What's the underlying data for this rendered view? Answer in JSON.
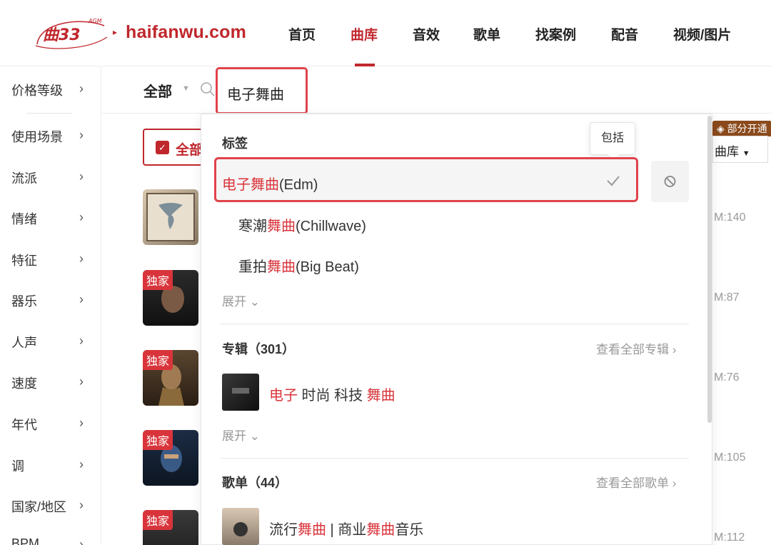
{
  "header": {
    "logo_text": "曲33",
    "logo_superscript": "AGM",
    "site_name": "haifanwu.com",
    "nav": [
      "首页",
      "曲库",
      "音效",
      "歌单",
      "找案例",
      "配音",
      "视频/图片"
    ],
    "active_nav": "曲库"
  },
  "sidebar": {
    "items": [
      "价格等级",
      "使用场景",
      "流派",
      "情绪",
      "特征",
      "器乐",
      "人声",
      "速度",
      "年代",
      "调",
      "国家/地区",
      "BPM"
    ]
  },
  "search": {
    "scope": "全部",
    "query": "电子舞曲"
  },
  "background": {
    "all_checkbox_label": "全部",
    "badge_label": "部分开通",
    "select_label": "曲库",
    "badges": [
      "独家",
      "独家",
      "独家",
      "独家"
    ],
    "right_values": [
      "M:140",
      "M:87",
      "M:76",
      "M:105",
      "M:112"
    ]
  },
  "dropdown": {
    "tags_title": "标签",
    "tooltip": "包括",
    "tags": [
      {
        "hl": "电子舞曲",
        "rest": "(Edm)",
        "prefix": ""
      },
      {
        "prefix": "寒潮",
        "hl": "舞曲",
        "rest": "(Chillwave)"
      },
      {
        "prefix": "重拍",
        "hl": "舞曲",
        "rest": "(Big Beat)"
      }
    ],
    "expand_label": "展开",
    "albums_title": "专辑（301）",
    "albums_link": "查看全部专辑",
    "album_item": {
      "p1": "电子",
      "p2": " 时尚 科技 ",
      "p3": "舞曲"
    },
    "playlists_title": "歌单（44）",
    "playlists_link": "查看全部歌单",
    "playlist_item": {
      "p1": "流行",
      "p2": "舞曲",
      "p3": " | 商业",
      "p4": "舞曲",
      "p5": "音乐"
    }
  },
  "colors": {
    "brand": "#c0272d",
    "highlight": "#d9343b",
    "annotation_box": "#e0434a"
  }
}
